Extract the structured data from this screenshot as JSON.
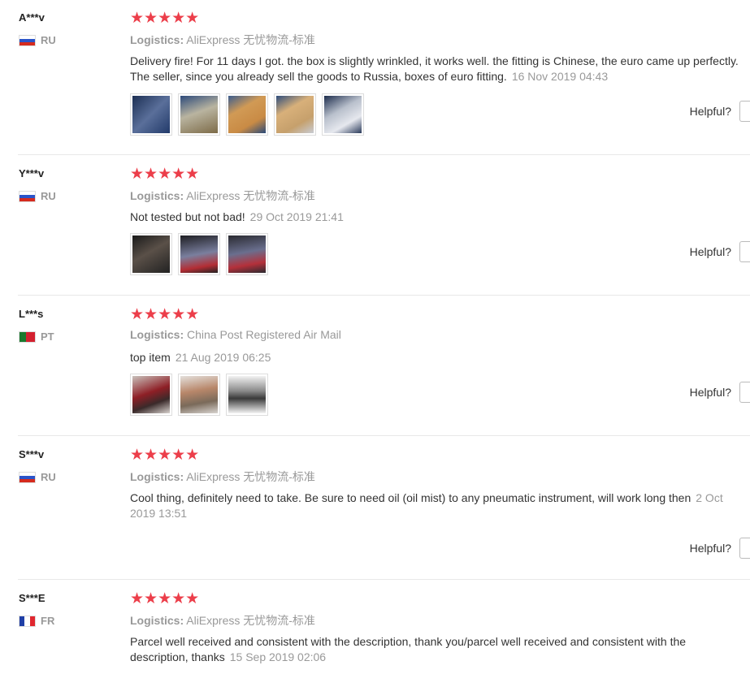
{
  "helpful_label": "Helpful?",
  "logistics_label": "Logistics:",
  "reviews": [
    {
      "name": "A***v",
      "country": "RU",
      "logistics": "AliExpress 无忧物流-标准",
      "text": "Delivery fire! For 11 days I got. the box is slightly wrinkled, it works well. the fitting is Chinese, the euro came up perfectly. The seller, since you already sell the goods to Russia, boxes of euro fitting.",
      "date": "16 Nov 2019 04:43"
    },
    {
      "name": "Y***v",
      "country": "RU",
      "logistics": "AliExpress 无忧物流-标准",
      "text": "Not tested but not bad!",
      "date": "29 Oct 2019 21:41"
    },
    {
      "name": "L***s",
      "country": "PT",
      "logistics": "China Post Registered Air Mail",
      "text": "top item",
      "date": "21 Aug 2019 06:25"
    },
    {
      "name": "S***v",
      "country": "RU",
      "logistics": "AliExpress 无忧物流-标准",
      "text": "Cool thing, definitely need to take. Be sure to need oil (oil mist) to any pneumatic instrument, will work long then",
      "date": "2 Oct 2019 13:51"
    },
    {
      "name": "S***E",
      "country": "FR",
      "logistics": "AliExpress 无忧物流-标准",
      "text": "Parcel well received and consistent with the description, thank you/parcel well received and consistent with the description, thanks",
      "date": "15 Sep 2019 02:06"
    }
  ],
  "stars": "★★★★★"
}
